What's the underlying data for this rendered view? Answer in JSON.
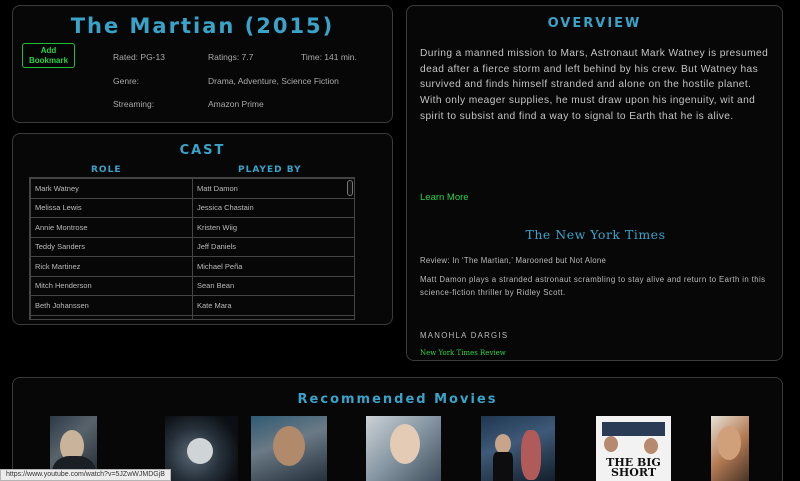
{
  "movie": {
    "title": "The Martian (2015)",
    "bookmark_button": "Add Bookmark",
    "rated_label": "Rated: PG-13",
    "ratings_label": "Ratings: 7.7",
    "time_label": "Time: 141 min.",
    "genre_label": "Genre:",
    "genre_value": "Drama, Adventure, Science Fiction",
    "streaming_label": "Streaming:",
    "streaming_value": "Amazon Prime"
  },
  "cast": {
    "title": "CAST",
    "role_header": "ROLE",
    "played_by_header": "PLAYED BY",
    "rows": [
      {
        "role": "Mark Watney",
        "actor": "Matt Damon"
      },
      {
        "role": "Melissa Lewis",
        "actor": "Jessica Chastain"
      },
      {
        "role": "Annie Montrose",
        "actor": "Kristen Wiig"
      },
      {
        "role": "Teddy Sanders",
        "actor": "Jeff Daniels"
      },
      {
        "role": "Rick Martinez",
        "actor": "Michael Peña"
      },
      {
        "role": "Mitch Henderson",
        "actor": "Sean Bean"
      },
      {
        "role": "Beth Johanssen",
        "actor": "Kate Mara"
      },
      {
        "role": "",
        "actor": ""
      }
    ]
  },
  "overview": {
    "title": "OVERVIEW",
    "summary": "During a manned mission to Mars, Astronaut Mark Watney is presumed dead after a fierce storm and left behind by his crew. But Watney has survived and finds himself stranded and alone on the hostile planet. With only meager supplies, he must draw upon his ingenuity, wit and spirit to subsist and find a way to signal to Earth that he is alive.",
    "learn_more": "Learn More",
    "source": "The New York Times",
    "review_title": "Review: In ‘The Martian,’ Marooned but Not Alone",
    "review_body": "Matt Damon plays a stranded astronaut scrambling to stay alive and return to Earth in this science-fiction thriller by Ridley Scott.",
    "author": "MANOHLA DARGIS",
    "review_link": "New York Times Review"
  },
  "recommended": {
    "title": "Recommended Movies",
    "posters": [
      {
        "icon": "poster-image-1"
      },
      {
        "icon": "poster-image-2"
      },
      {
        "icon": "poster-image-3"
      },
      {
        "icon": "poster-image-4"
      },
      {
        "icon": "poster-image-5"
      },
      {
        "icon": "poster-image-6",
        "text": "THE BIG SHORT"
      },
      {
        "icon": "poster-image-7"
      }
    ]
  },
  "status_bar": {
    "url": "https://www.youtube.com/watch?v=5JZwWJMDGjB"
  },
  "colors": {
    "accent": "#3aa3c9",
    "link": "#2bd24a",
    "background": "#000000"
  }
}
